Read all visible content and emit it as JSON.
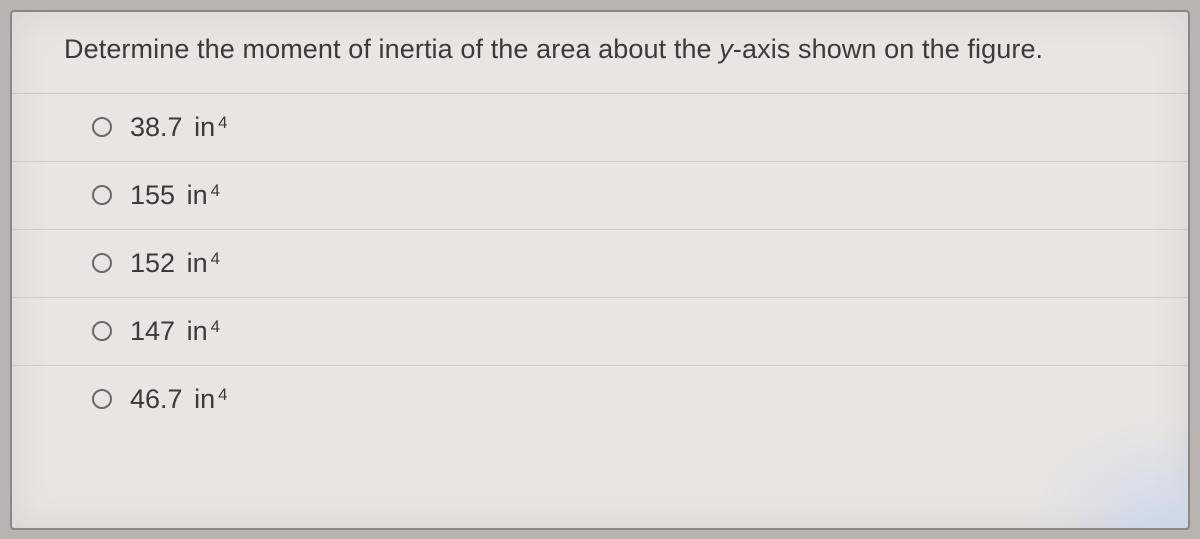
{
  "question": {
    "prefix": "Determine the moment of inertia of the area about the ",
    "axis": "y",
    "suffix": "-axis shown on the figure."
  },
  "options": [
    {
      "value": "38.7",
      "unit_base": "in",
      "unit_exp": "4"
    },
    {
      "value": "155",
      "unit_base": "in",
      "unit_exp": "4"
    },
    {
      "value": "152",
      "unit_base": "in",
      "unit_exp": "4"
    },
    {
      "value": "147",
      "unit_base": "in",
      "unit_exp": "4"
    },
    {
      "value": "46.7",
      "unit_base": "in",
      "unit_exp": "4"
    }
  ]
}
